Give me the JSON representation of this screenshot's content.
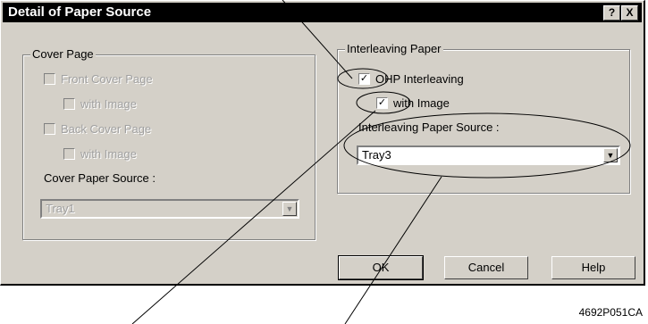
{
  "window": {
    "title": "Detail of Paper Source",
    "help_btn": "?",
    "close_btn": "X"
  },
  "cover_page": {
    "group_label": "Cover Page",
    "front_cover": "Front Cover Page",
    "front_with_image": "with Image",
    "back_cover": "Back Cover Page",
    "back_with_image": "with Image",
    "source_label": "Cover Paper Source :",
    "source_value": "Tray1"
  },
  "interleaving": {
    "group_label": "Interleaving Paper",
    "ohp": "OHP Interleaving",
    "with_image": "with Image",
    "source_label": "Interleaving Paper Source :",
    "source_value": "Tray3"
  },
  "buttons": {
    "ok": "OK",
    "cancel": "Cancel",
    "help": "Help"
  },
  "caption": "4692P051CA"
}
